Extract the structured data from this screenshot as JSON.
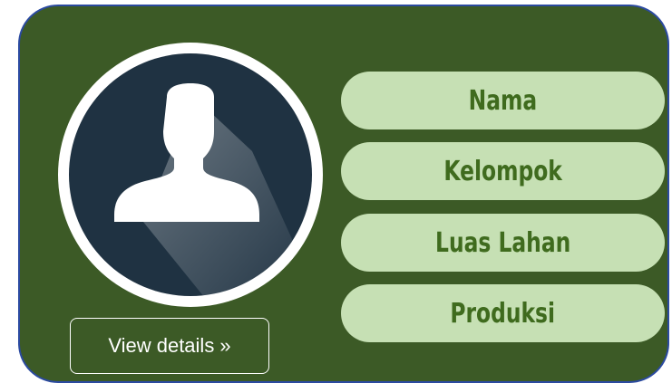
{
  "profile_card": {
    "fields": [
      {
        "label": "Nama"
      },
      {
        "label": "Kelompok"
      },
      {
        "label": "Luas Lahan"
      },
      {
        "label": "Produksi"
      }
    ],
    "details_button": {
      "label": "View details »"
    }
  },
  "colors": {
    "card_background": "#3c5a26",
    "card_border": "#2b4aa0",
    "pill_background": "#c6e0b4",
    "pill_text": "#3f6b1e",
    "avatar_circle": "#1f3242",
    "avatar_ring": "#ffffff"
  },
  "icons": {
    "avatar": "user-silhouette-icon"
  }
}
